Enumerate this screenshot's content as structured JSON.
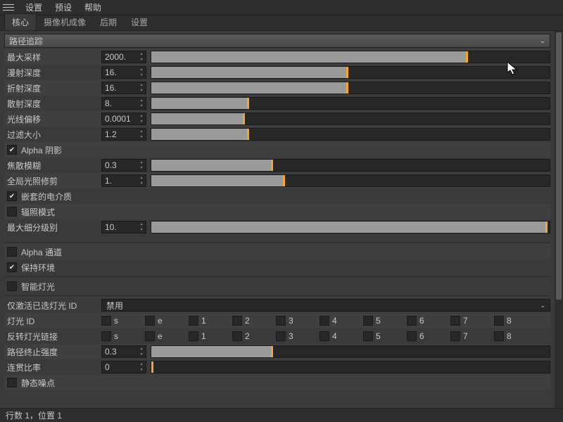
{
  "menu": {
    "settings": "设置",
    "presets": "预设",
    "help": "帮助"
  },
  "tabs": [
    "核心",
    "摄像机成像",
    "后期",
    "设置"
  ],
  "active_tab": 0,
  "section_title": "路径追踪",
  "params": [
    {
      "key": "max_samples",
      "label": "最大采样",
      "value": "2000.",
      "fill": 79
    },
    {
      "key": "diffuse_depth",
      "label": "漫射深度",
      "value": "16.",
      "fill": 49
    },
    {
      "key": "refraction_depth",
      "label": "折射深度",
      "value": "16.",
      "fill": 49
    },
    {
      "key": "scatter_depth",
      "label": "散射深度",
      "value": "8.",
      "fill": 24
    },
    {
      "key": "ray_offset",
      "label": "光线偏移",
      "value": "0.0001",
      "fill": 23
    },
    {
      "key": "filter_size",
      "label": "过滤大小",
      "value": "1.2",
      "fill": 24
    }
  ],
  "alpha_shadow": {
    "label": "Alpha 阴影",
    "checked": true
  },
  "caustic_blur": {
    "label": "焦散模糊",
    "value": "0.3",
    "fill": 30
  },
  "gi_clamp": {
    "label": "全局光照修剪",
    "value": "1.",
    "fill": 33
  },
  "nested_dielectric": {
    "label": "嵌套的电介质",
    "checked": true
  },
  "irradiance_mode": {
    "label": "辐照模式",
    "checked": false
  },
  "max_subdiv": {
    "label": "最大细分级别",
    "value": "10.",
    "fill": 99
  },
  "alpha_channel": {
    "label": "Alpha 通道",
    "checked": false
  },
  "keep_env": {
    "label": "保持环境",
    "checked": true
  },
  "smart_light": {
    "label": "智能灯光",
    "checked": false
  },
  "activate_light_id": {
    "label": "仅激活已选灯光 ID",
    "value": "禁用"
  },
  "light_id": {
    "label": "灯光 ID",
    "opts": [
      "s",
      "e",
      "1",
      "2",
      "3",
      "4",
      "5",
      "6",
      "7",
      "8"
    ]
  },
  "invert_light": {
    "label": "反转灯光链接",
    "opts": [
      "s",
      "e",
      "1",
      "2",
      "3",
      "4",
      "5",
      "6",
      "7",
      "8"
    ]
  },
  "termination": {
    "label": "路径终止强度",
    "value": "0.3",
    "fill": 30
  },
  "coherence": {
    "label": "连贯比率",
    "value": "0",
    "fill": 0
  },
  "static_noise": {
    "label": "静态噪点",
    "checked": false
  },
  "status": "行数 1，位置 1"
}
